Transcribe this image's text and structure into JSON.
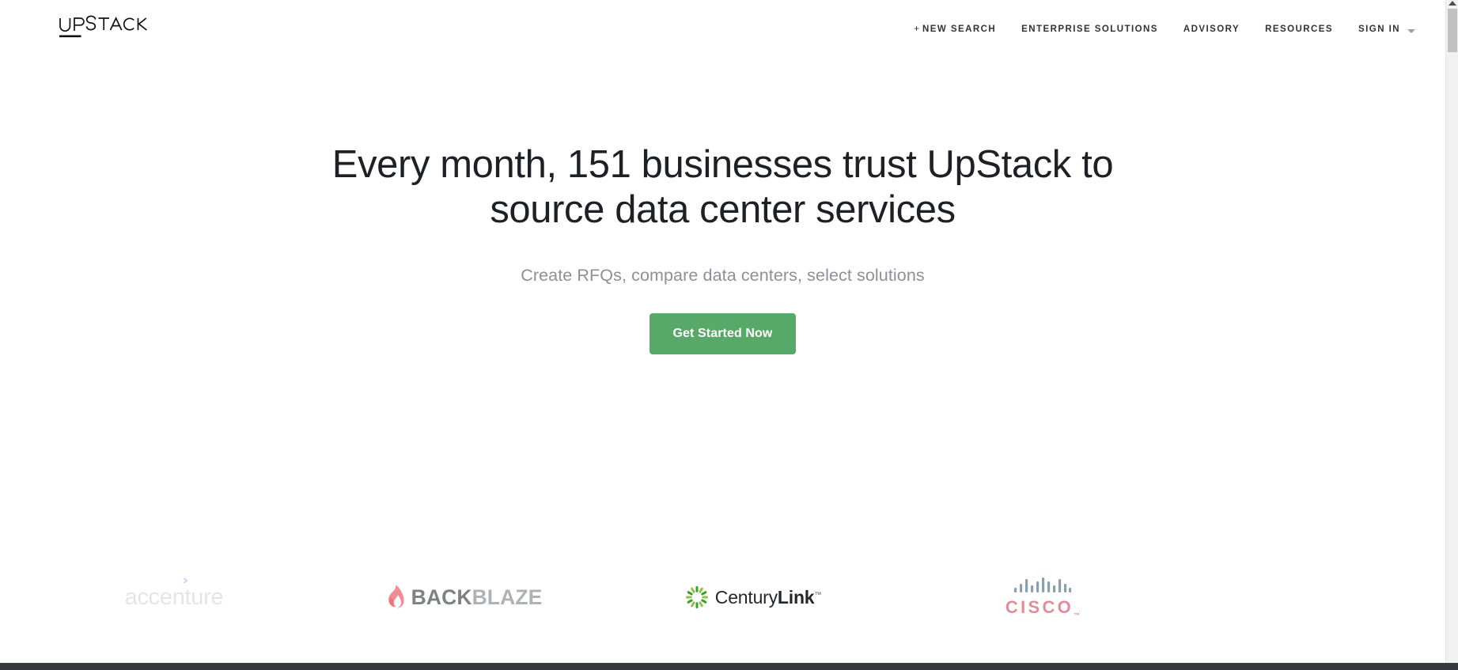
{
  "header": {
    "logo": {
      "text": "UPSTACK",
      "icon": "upstack-wordmark-logo"
    },
    "nav_items": [
      {
        "label": "+ NEW SEARCH",
        "plus": "+",
        "text": "NEW SEARCH",
        "name": "new-search"
      },
      {
        "label": "ENTERPRISE SOLUTIONS",
        "name": "enterprise-solutions"
      },
      {
        "label": "ADVISORY",
        "name": "advisory"
      },
      {
        "label": "RESOURCES",
        "name": "resources"
      },
      {
        "label": "SIGN IN",
        "name": "sign-in",
        "has_dropdown": true
      }
    ]
  },
  "hero": {
    "headline": "Every month, 151 businesses trust UpStack to source data center services",
    "headline_count": "151",
    "subheadline": "Create RFQs, compare data centers, select solutions",
    "cta_label": "Get Started Now"
  },
  "logo_strip": {
    "brands": [
      {
        "name": "accenture",
        "word": "accenture",
        "arrow": "›",
        "color": "#e3e5e8",
        "accent": "#c5dcf5"
      },
      {
        "name": "backblaze",
        "word_dark": "BACK",
        "word_light": "BLAZE",
        "icon": "flame-icon",
        "color_dark": "#7e8285",
        "color_light": "#aeb2b5",
        "accent": "#ef8d94"
      },
      {
        "name": "centurylink",
        "word_regular": "Century",
        "word_bold": "Link",
        "trademark": "™",
        "icon": "radial-burst-icon",
        "color": "#24282b",
        "accent": "#4fa845"
      },
      {
        "name": "cisco",
        "word": "CISCO",
        "trademark": "™",
        "icon": "signal-bars-icon",
        "color": "#dd8e99",
        "accent": "#8aa0ad"
      }
    ]
  },
  "colors": {
    "cta_green": "#58a869",
    "headline": "#1d2024",
    "subheadline": "#8d9096",
    "nav_text": "#2f3237",
    "page_background": "#ffffff",
    "bottom_bar": "#36393e",
    "scrollbar_track": "#f1f1f1",
    "scrollbar_thumb": "#c1c1c1"
  }
}
